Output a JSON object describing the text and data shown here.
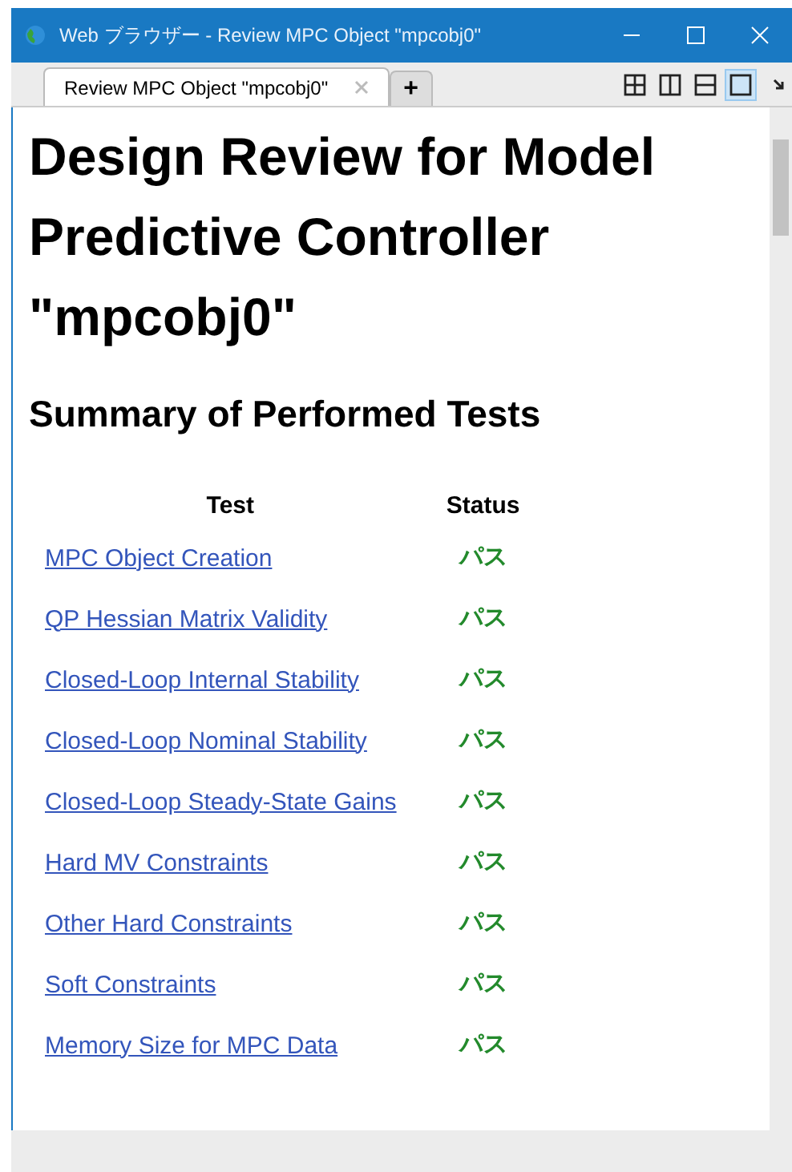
{
  "window": {
    "title": "Web ブラウザー - Review MPC Object \"mpcobj0\""
  },
  "tabs": [
    {
      "label": "Review MPC Object \"mpcobj0\"",
      "selected": true
    }
  ],
  "new_tab": "+",
  "layout_buttons": [
    {
      "kind": "grid",
      "selected": false
    },
    {
      "kind": "columns",
      "selected": false
    },
    {
      "kind": "rows",
      "selected": false
    },
    {
      "kind": "single",
      "selected": true
    }
  ],
  "heading": "Design Review for Model Predictive Controller \"mpcobj0\"",
  "subheading": "Summary of Performed Tests",
  "table": {
    "columns": [
      "Test",
      "Status"
    ],
    "rows": [
      {
        "test": "MPC Object Creation",
        "status": "パス"
      },
      {
        "test": "QP Hessian Matrix Validity",
        "status": "パス"
      },
      {
        "test": "Closed-Loop Internal Stability",
        "status": "パス"
      },
      {
        "test": "Closed-Loop Nominal Stability",
        "status": "パス"
      },
      {
        "test": "Closed-Loop Steady-State Gains",
        "status": "パス"
      },
      {
        "test": "Hard MV Constraints",
        "status": "パス"
      },
      {
        "test": "Other Hard Constraints",
        "status": "パス"
      },
      {
        "test": "Soft Constraints",
        "status": "パス"
      },
      {
        "test": "Memory Size for MPC Data",
        "status": "パス"
      }
    ]
  }
}
